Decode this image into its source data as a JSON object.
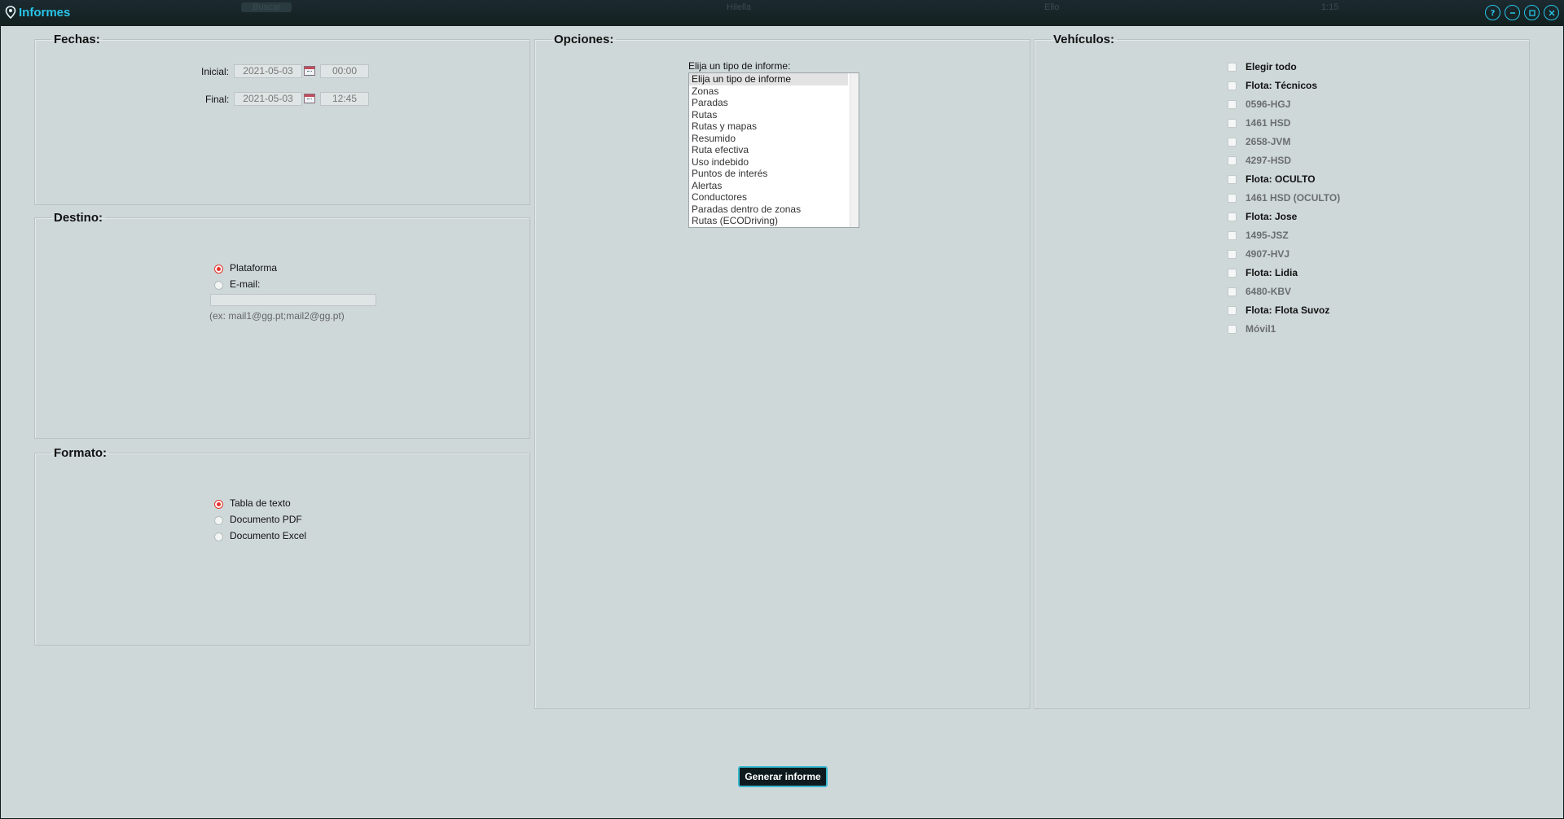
{
  "window": {
    "title": "Informes",
    "map_ghost_texts": [
      "Buscar",
      "Hilella",
      "Ello",
      "1:15"
    ]
  },
  "fechas": {
    "legend": "Fechas:",
    "initial_label": "Inicial:",
    "initial_date": "2021-05-03",
    "initial_time": "00:00",
    "final_label": "Final:",
    "final_date": "2021-05-03",
    "final_time": "12:45"
  },
  "destino": {
    "legend": "Destino:",
    "option_platform": "Plataforma",
    "option_email": "E-mail:",
    "email_value": "",
    "email_hint": "(ex: mail1@gg.pt;mail2@gg.pt)",
    "selected": "Plataforma"
  },
  "formato": {
    "legend": "Formato:",
    "options": [
      "Tabla de texto",
      "Documento PDF",
      "Documento Excel"
    ],
    "selected": "Tabla de texto"
  },
  "opciones": {
    "legend": "Opciones:",
    "select_label": "Elija un tipo de informe:",
    "report_types": [
      "Elija un tipo de informe",
      "Zonas",
      "Paradas",
      "Rutas",
      "Rutas y mapas",
      "Resumido",
      "Ruta efectiva",
      "Uso indebido",
      "Puntos de interés",
      "Alertas",
      "Conductores",
      "Paradas dentro de zonas",
      "Rutas (ECODriving)"
    ],
    "selected": "Elija un tipo de informe"
  },
  "vehiculos": {
    "legend": "Vehículos:",
    "items": [
      {
        "label": "Elegir todo",
        "kind": "fleet"
      },
      {
        "label": "Flota: Técnicos",
        "kind": "fleet"
      },
      {
        "label": "0596-HGJ",
        "kind": "vehicle"
      },
      {
        "label": "1461 HSD",
        "kind": "vehicle"
      },
      {
        "label": "2658-JVM",
        "kind": "vehicle"
      },
      {
        "label": "4297-HSD",
        "kind": "vehicle"
      },
      {
        "label": "Flota: OCULTO",
        "kind": "fleet"
      },
      {
        "label": "1461 HSD (OCULTO)",
        "kind": "vehicle"
      },
      {
        "label": "Flota: Jose",
        "kind": "fleet"
      },
      {
        "label": "1495-JSZ",
        "kind": "vehicle"
      },
      {
        "label": "4907-HVJ",
        "kind": "vehicle"
      },
      {
        "label": "Flota: Lidia",
        "kind": "fleet"
      },
      {
        "label": "6480-KBV",
        "kind": "vehicle"
      },
      {
        "label": "Flota: Flota Suvoz",
        "kind": "fleet"
      },
      {
        "label": "Móvil1",
        "kind": "vehicle"
      }
    ]
  },
  "actions": {
    "generate_label": "Generar informe"
  },
  "colors": {
    "accent": "#28c4e8",
    "panel_bg": "#cfd8d9",
    "radio_selected": "#e2342b"
  }
}
